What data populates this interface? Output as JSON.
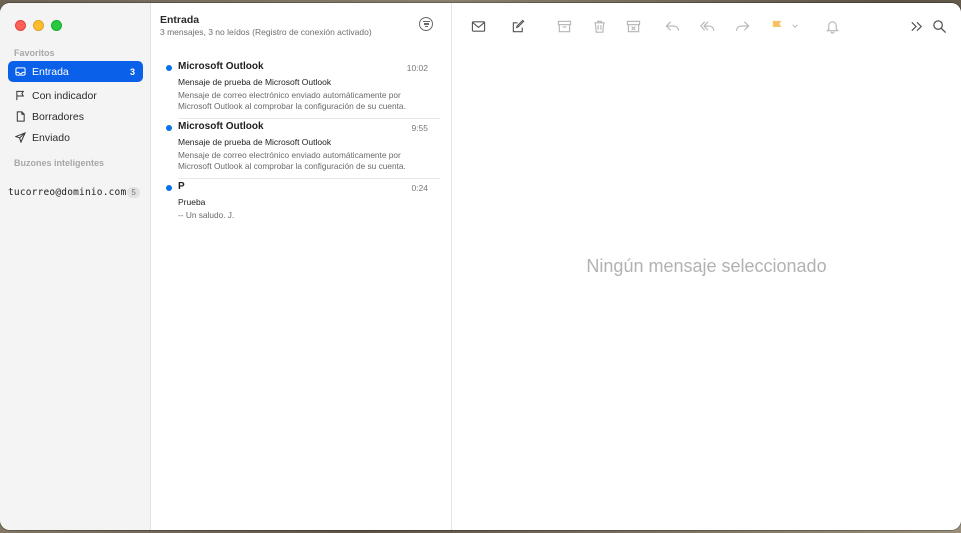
{
  "sidebar": {
    "favorites_label": "Favoritos",
    "items": [
      {
        "label": "Entrada",
        "count": "3"
      },
      {
        "label": "Con indicador"
      },
      {
        "label": "Borradores"
      },
      {
        "label": "Enviado"
      }
    ],
    "smart_label": "Buzones inteligentes",
    "account": {
      "label": "tucorreo@dominio.com",
      "count": "5"
    }
  },
  "list": {
    "title": "Entrada",
    "subtitle": "3 mensajes, 3 no leídos (Registro de conexión activado)",
    "messages": [
      {
        "from": "Microsoft Outlook",
        "time": "10:02",
        "subject": "Mensaje de prueba de Microsoft Outlook",
        "preview": "Mensaje de correo electrónico enviado automáticamente por Microsoft Outlook al comprobar la configuración de su cuenta."
      },
      {
        "from": "Microsoft Outlook",
        "time": "9:55",
        "subject": "Mensaje de prueba de Microsoft Outlook",
        "preview": "Mensaje de correo electrónico enviado automáticamente por Microsoft Outlook al comprobar la configuración de su cuenta."
      },
      {
        "from": "P",
        "time": "0:24",
        "subject": "Prueba",
        "preview": "-- Un saludo. J."
      }
    ]
  },
  "reader": {
    "empty_text": "Ningún mensaje seleccionado"
  },
  "colors": {
    "accent": "#0a60e8",
    "unread_dot": "#0a72e8",
    "flag": "#f5b731"
  }
}
